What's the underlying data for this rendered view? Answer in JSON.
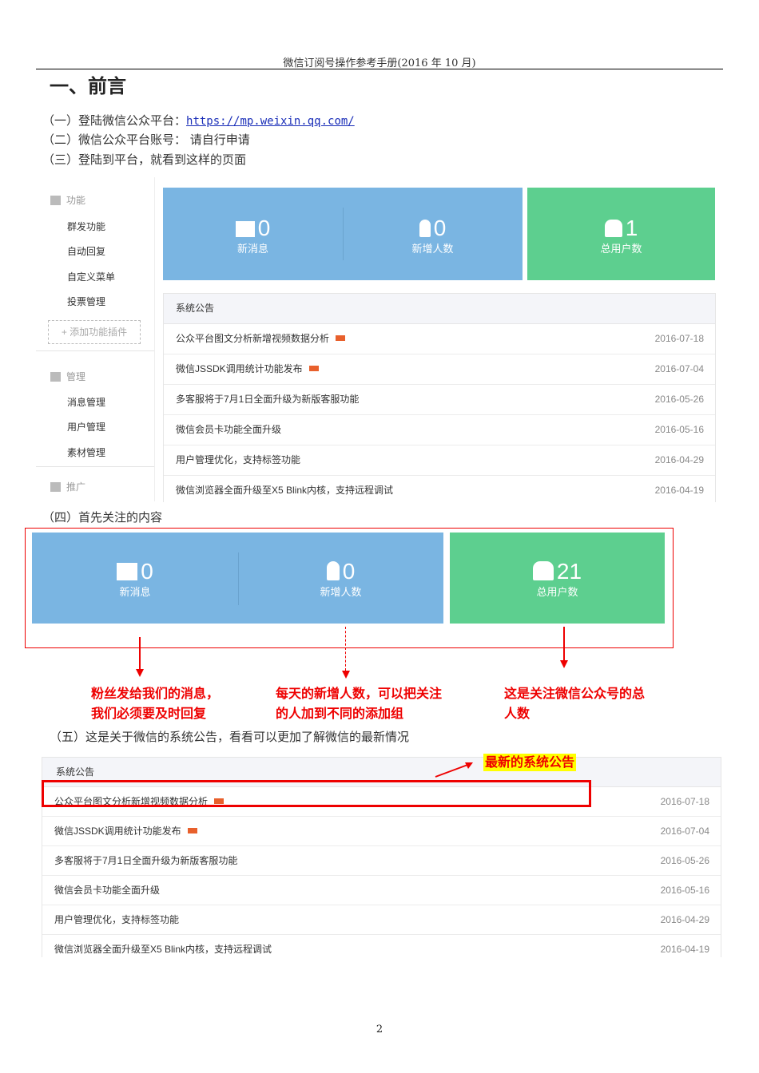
{
  "header": "微信订阅号操作参考手册(2016 年 10 月)",
  "title": "一、前言",
  "lines": [
    {
      "prefix": "（一）登陆微信公众平台：",
      "link": "https://mp.weixin.qq.com/"
    },
    {
      "prefix": "（二）微信公众平台账号：  请自行申请"
    },
    {
      "prefix": "（三）登陆到平台，就看到这样的页面"
    }
  ],
  "sidebar": {
    "groups": [
      {
        "label": "功能",
        "icon": "grid-icon",
        "items": [
          "群发功能",
          "自动回复",
          "自定义菜单",
          "投票管理"
        ]
      },
      {
        "label": "管理",
        "icon": "inbox-icon",
        "items": [
          "消息管理",
          "用户管理",
          "素材管理"
        ]
      },
      {
        "label": "推广",
        "icon": "megaphone-icon",
        "items": []
      }
    ],
    "add_plugin": "+ 添加功能插件"
  },
  "stats1": [
    {
      "value": "0",
      "label": "新消息"
    },
    {
      "value": "0",
      "label": "新增人数"
    },
    {
      "value": "1",
      "label": "总用户数"
    }
  ],
  "notices": {
    "title": "系统公告",
    "items": [
      {
        "text": "公众平台图文分析新增视频数据分析",
        "date": "2016-07-18",
        "new": true
      },
      {
        "text": "微信JSSDK调用统计功能发布",
        "date": "2016-07-04",
        "new": true
      },
      {
        "text": "多客服将于7月1日全面升级为新版客服功能",
        "date": "2016-05-26"
      },
      {
        "text": "微信会员卡功能全面升级",
        "date": "2016-05-16"
      },
      {
        "text": "用户管理优化，支持标签功能",
        "date": "2016-04-29"
      },
      {
        "text": "微信浏览器全面升级至X5 Blink内核，支持远程调试",
        "date": "2016-04-19"
      }
    ]
  },
  "section4": "（四）首先关注的内容",
  "stats2": [
    {
      "value": "0",
      "label": "新消息"
    },
    {
      "value": "0",
      "label": "新增人数"
    },
    {
      "value": "21",
      "label": "总用户数"
    }
  ],
  "notes": [
    {
      "l1": "粉丝发给我们的消息，",
      "l2": "我们必须要及时回复"
    },
    {
      "l1": "每天的新增人数，可以把关注",
      "l2": "的人加到不同的添加组"
    },
    {
      "l1": "这是关注微信公众号的总",
      "l2": "人数"
    }
  ],
  "section5": "（五）这是关于微信的系统公告，看看可以更加了解微信的最新情况",
  "latest_label": "最新的系统公告",
  "new_badge": "new",
  "page_number": "2",
  "colors": {
    "blue": "#7ab5e2",
    "green": "#5dcf8f",
    "red": "#e00000"
  }
}
